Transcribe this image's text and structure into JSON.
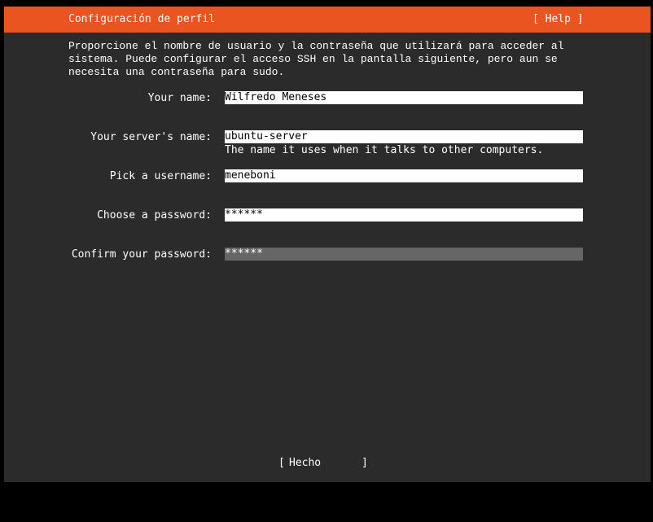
{
  "header": {
    "title": "Configuración de perfil",
    "help": "[ Help ]",
    "color": "#e95420"
  },
  "intro": "Proporcione el nombre de usuario y la contraseña que utilizará para acceder al\nsistema. Puede configurar el acceso SSH en la pantalla siguiente, pero aun se\nnecesita una contraseña para sudo.",
  "form": {
    "name": {
      "label": "Your name:",
      "value": "Wilfredo Meneses"
    },
    "server": {
      "label": "Your server's name:",
      "value": "ubuntu-server",
      "hint": "The name it uses when it talks to other computers."
    },
    "username": {
      "label": "Pick a username:",
      "value": "meneboni"
    },
    "password": {
      "label": "Choose a password:",
      "value": "******"
    },
    "confirm": {
      "label": "Confirm your password:",
      "value": "******"
    }
  },
  "done": {
    "left_bracket": "[",
    "label": "Hecho",
    "right_bracket": "]"
  }
}
